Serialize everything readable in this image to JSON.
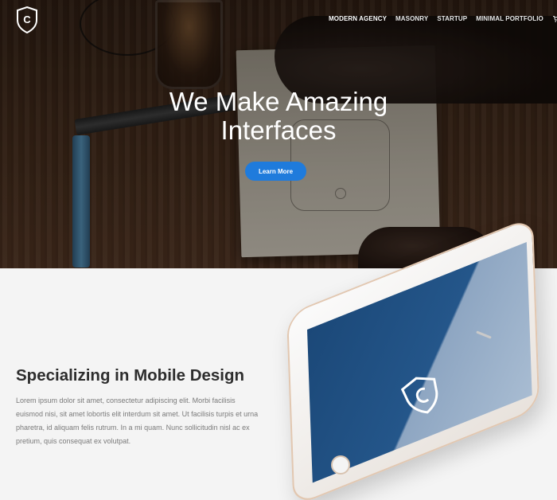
{
  "nav": {
    "items": [
      {
        "label": "MODERN AGENCY"
      },
      {
        "label": "MASONRY"
      },
      {
        "label": "STARTUP"
      },
      {
        "label": "MINIMAL PORTFOLIO"
      }
    ],
    "active_index": 0,
    "cart_icon": "cart-icon",
    "logo_letter": "C"
  },
  "hero": {
    "title_line1": "We Make Amazing",
    "title_line2": "Interfaces",
    "button_label": "Learn More"
  },
  "feature": {
    "title": "Specializing in Mobile Design",
    "body": "Lorem ipsum dolor sit amet, consectetur adipiscing elit. Morbi facilisis euismod nisi, sit amet lobortis elit interdum sit amet. Ut facilisis turpis et urna pharetra, id aliquam felis rutrum. In a mi quam. Nunc sollicitudin nisl ac ex pretium, quis consequat ex volutpat."
  },
  "colors": {
    "accent": "#1f7bdc",
    "hero_dark": "#3b2618",
    "section_bg": "#f4f4f4",
    "title_text": "#2d2d2d",
    "body_text": "#7a7a7a",
    "phone_screen": "#1b4878"
  }
}
